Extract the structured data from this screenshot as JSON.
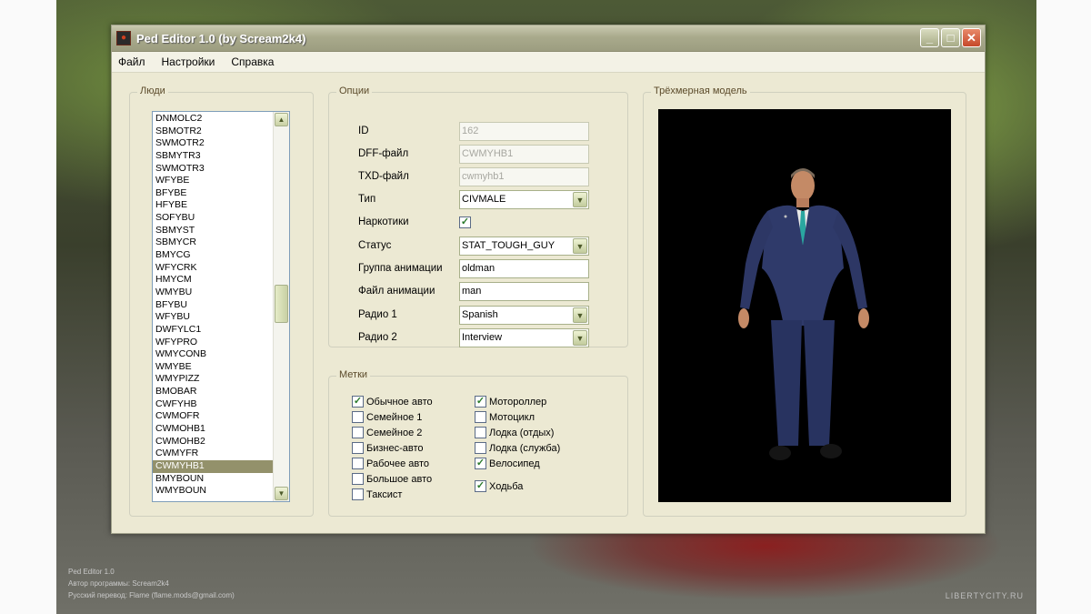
{
  "window": {
    "title": "Ped Editor 1.0 (by Scream2k4)",
    "controls": {
      "minimize": "_",
      "maximize": "□",
      "close": "✕"
    }
  },
  "menu": [
    "Файл",
    "Настройки",
    "Справка"
  ],
  "people": {
    "title": "Люди",
    "items": [
      "DNMOLC2",
      "SBMOTR2",
      "SWMOTR2",
      "SBMYTR3",
      "SWMOTR3",
      "WFYBE",
      "BFYBE",
      "HFYBE",
      "SOFYBU",
      "SBMYST",
      "SBMYCR",
      "BMYCG",
      "WFYCRK",
      "HMYCM",
      "WMYBU",
      "BFYBU",
      "WFYBU",
      "DWFYLC1",
      "WFYPRO",
      "WMYCONB",
      "WMYBE",
      "WMYPIZZ",
      "BMOBAR",
      "CWFYHB",
      "CWMOFR",
      "CWMOHB1",
      "CWMOHB2",
      "CWMYFR",
      "CWMYHB1",
      "BMYBOUN",
      "WMYBOUN"
    ],
    "selected": "CWMYHB1"
  },
  "options": {
    "title": "Опции",
    "fields": [
      {
        "label": "ID",
        "value": "162"
      },
      {
        "label": "DFF-файл",
        "value": "CWMYHB1"
      },
      {
        "label": "TXD-файл",
        "value": "cwmyhb1"
      },
      {
        "label": "Тип",
        "value": "CIVMALE"
      },
      {
        "label": "Наркотики",
        "value": "checked"
      },
      {
        "label": "Статус",
        "value": "STAT_TOUGH_GUY"
      },
      {
        "label": "Группа анимации",
        "value": "oldman"
      },
      {
        "label": "Файл анимации",
        "value": "man"
      },
      {
        "label": "Радио 1",
        "value": "Spanish"
      },
      {
        "label": "Радио 2",
        "value": "Interview"
      }
    ]
  },
  "tags": {
    "title": "Метки",
    "left": [
      {
        "label": "Обычное авто",
        "checked": true
      },
      {
        "label": "Семейное 1",
        "checked": false
      },
      {
        "label": "Семейное 2",
        "checked": false
      },
      {
        "label": "Бизнес-авто",
        "checked": false
      },
      {
        "label": "Рабочее авто",
        "checked": false
      },
      {
        "label": "Большое авто",
        "checked": false
      },
      {
        "label": "Таксист",
        "checked": false
      }
    ],
    "right": [
      {
        "label": "Мотороллер",
        "checked": true
      },
      {
        "label": "Мотоцикл",
        "checked": false
      },
      {
        "label": "Лодка (отдых)",
        "checked": false
      },
      {
        "label": "Лодка (служба)",
        "checked": false
      },
      {
        "label": "Велосипед",
        "checked": true
      },
      {
        "label": "Ходьба",
        "checked": true
      }
    ]
  },
  "model": {
    "title": "Трёхмерная модель"
  },
  "background": {
    "credits": [
      "Ped Editor 1.0",
      "Автор программы: Scream2k4",
      "Русский перевод: Flame (flame.mods@gmail.com)"
    ],
    "watermark": "LIBERTYCITY.RU"
  },
  "colors": {
    "selection": "#93916b",
    "titlebar": "#a9aa8c",
    "panel": "#ece9d3",
    "check": "#2a7a2a"
  }
}
